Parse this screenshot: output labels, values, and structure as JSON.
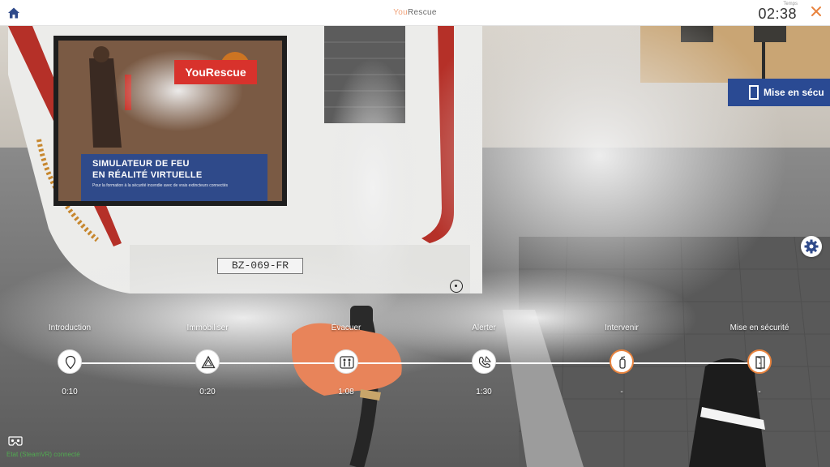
{
  "topbar": {
    "brand_part1": "You",
    "brand_part2": "Rescue",
    "timer_label": "Temps",
    "timer": "02:38"
  },
  "scene": {
    "poster_brand": "YouRescue",
    "poster_line1": "SIMULATEUR DE FEU",
    "poster_line2": "EN RÉALITÉ VIRTUELLE",
    "poster_small": "Pour la formation à la sécurité incendie avec de vrais extincteurs connectés",
    "plate": "BZ-069-FR",
    "signboard": "Mise en sécu"
  },
  "timeline": {
    "steps": [
      {
        "title": "Introduction",
        "time": "0:10",
        "icon": "location-pin-icon"
      },
      {
        "title": "Immobiliser",
        "time": "0:20",
        "icon": "warning-triangle-icon"
      },
      {
        "title": "Évacuer",
        "time": "1:08",
        "icon": "evacuate-people-icon"
      },
      {
        "title": "Alerter",
        "time": "1:30",
        "icon": "phone-alert-icon"
      },
      {
        "title": "Intervenir",
        "time": "-",
        "icon": "extinguisher-icon"
      },
      {
        "title": "Mise en sécurité",
        "time": "-",
        "icon": "exit-door-icon"
      }
    ]
  },
  "footer": {
    "vr_status": "Etat (SteamVR) connecté"
  },
  "colors": {
    "accent": "#e8833e",
    "poster_red": "#d8322c",
    "sign_blue": "#2a4a93"
  }
}
